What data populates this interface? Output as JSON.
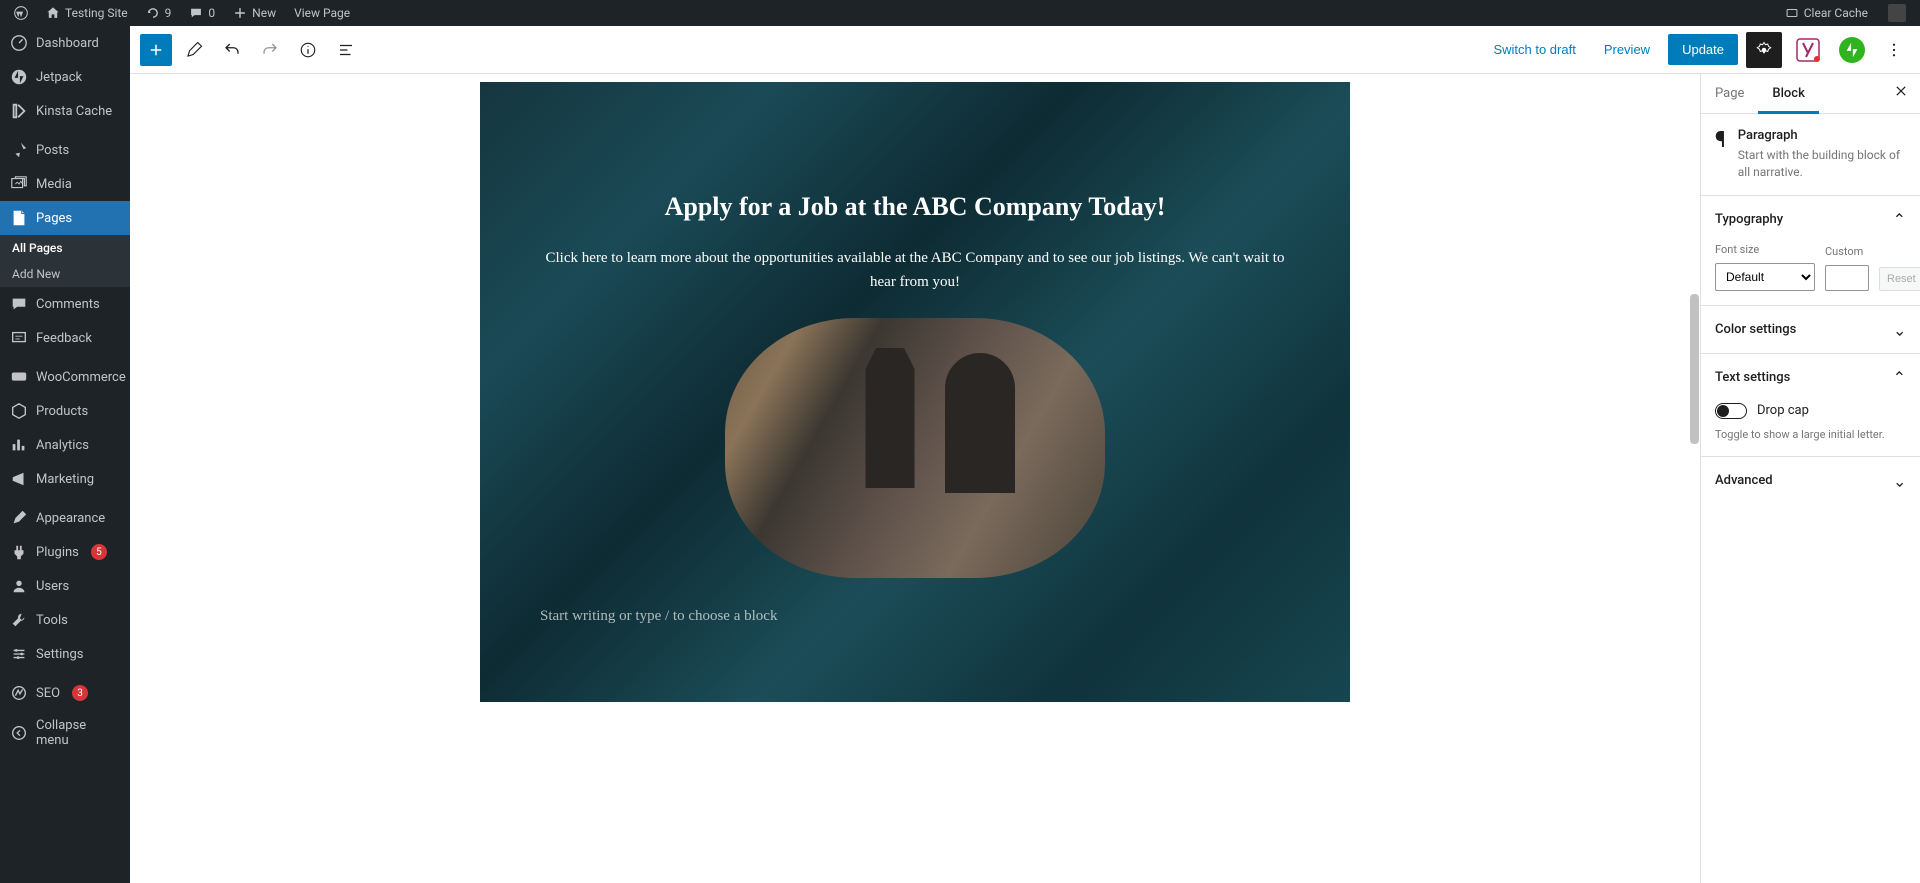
{
  "adminbar": {
    "site_name": "Testing Site",
    "updates_count": "9",
    "comments_count": "0",
    "new_label": "New",
    "view_page": "View Page",
    "clear_cache": "Clear Cache"
  },
  "sidebar": {
    "items": [
      {
        "label": "Dashboard",
        "icon": "dashboard"
      },
      {
        "label": "Jetpack",
        "icon": "jetpack"
      },
      {
        "label": "Kinsta Cache",
        "icon": "kinsta"
      },
      {
        "label": "Posts",
        "icon": "pin"
      },
      {
        "label": "Media",
        "icon": "media"
      },
      {
        "label": "Pages",
        "icon": "page",
        "active": true
      },
      {
        "label": "Comments",
        "icon": "comment"
      },
      {
        "label": "Feedback",
        "icon": "feedback"
      },
      {
        "label": "WooCommerce",
        "icon": "woo"
      },
      {
        "label": "Products",
        "icon": "product"
      },
      {
        "label": "Analytics",
        "icon": "analytics"
      },
      {
        "label": "Marketing",
        "icon": "marketing"
      },
      {
        "label": "Appearance",
        "icon": "appearance"
      },
      {
        "label": "Plugins",
        "icon": "plugins",
        "badge": "5"
      },
      {
        "label": "Users",
        "icon": "users"
      },
      {
        "label": "Tools",
        "icon": "tools"
      },
      {
        "label": "Settings",
        "icon": "settings"
      },
      {
        "label": "SEO",
        "icon": "seo",
        "badge": "3"
      },
      {
        "label": "Collapse menu",
        "icon": "collapse"
      }
    ],
    "submenu": {
      "all_pages": "All Pages",
      "add_new": "Add New"
    }
  },
  "header": {
    "switch_draft": "Switch to draft",
    "preview": "Preview",
    "update": "Update"
  },
  "content": {
    "title": "Apply for a Job at the ABC Company Today!",
    "paragraph": "Click here to learn more about the opportunities available at the ABC Company and to see our job listings. We can't wait to hear from you!",
    "placeholder": "Start writing or type / to choose a block"
  },
  "settings": {
    "tab_page": "Page",
    "tab_block": "Block",
    "block_name": "Paragraph",
    "block_desc": "Start with the building block of all narrative.",
    "typography": {
      "title": "Typography",
      "font_size_label": "Font size",
      "font_size_value": "Default",
      "custom_label": "Custom",
      "reset": "Reset"
    },
    "color": {
      "title": "Color settings"
    },
    "text": {
      "title": "Text settings",
      "dropcap": "Drop cap",
      "dropcap_help": "Toggle to show a large initial letter."
    },
    "advanced": {
      "title": "Advanced"
    }
  }
}
